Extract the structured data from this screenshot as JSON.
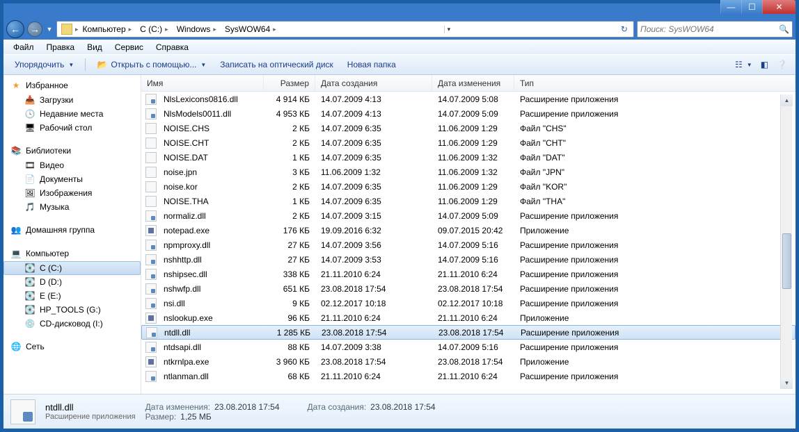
{
  "window": {
    "title": ""
  },
  "nav": {
    "breadcrumb": [
      "Компьютер",
      "C (C:)",
      "Windows",
      "SysWOW64"
    ],
    "search_placeholder": "Поиск: SysWOW64"
  },
  "menubar": [
    "Файл",
    "Правка",
    "Вид",
    "Сервис",
    "Справка"
  ],
  "toolbar": {
    "organize": "Упорядочить",
    "open_with": "Открыть с помощью...",
    "burn": "Записать на оптический диск",
    "new_folder": "Новая папка"
  },
  "sidebar": {
    "favorites": {
      "title": "Избранное",
      "items": [
        "Загрузки",
        "Недавние места",
        "Рабочий стол"
      ]
    },
    "libraries": {
      "title": "Библиотеки",
      "items": [
        "Видео",
        "Документы",
        "Изображения",
        "Музыка"
      ]
    },
    "homegroup": {
      "title": "Домашняя группа"
    },
    "computer": {
      "title": "Компьютер",
      "items": [
        "C (C:)",
        "D (D:)",
        "E (E:)",
        "HP_TOOLS (G:)",
        "CD-дисковод (I:)"
      ]
    },
    "network": {
      "title": "Сеть"
    }
  },
  "columns": {
    "name": "Имя",
    "size": "Размер",
    "created": "Дата создания",
    "modified": "Дата изменения",
    "type": "Тип"
  },
  "files": [
    {
      "icon": "dll",
      "name": "NlsLexicons0816.dll",
      "size": "4 914 КБ",
      "created": "14.07.2009 4:13",
      "modified": "14.07.2009 5:08",
      "type": "Расширение приложения"
    },
    {
      "icon": "dll",
      "name": "NlsModels0011.dll",
      "size": "4 953 КБ",
      "created": "14.07.2009 4:13",
      "modified": "14.07.2009 5:09",
      "type": "Расширение приложения"
    },
    {
      "icon": "file",
      "name": "NOISE.CHS",
      "size": "2 КБ",
      "created": "14.07.2009 6:35",
      "modified": "11.06.2009 1:29",
      "type": "Файл \"CHS\""
    },
    {
      "icon": "file",
      "name": "NOISE.CHT",
      "size": "2 КБ",
      "created": "14.07.2009 6:35",
      "modified": "11.06.2009 1:29",
      "type": "Файл \"CHT\""
    },
    {
      "icon": "file",
      "name": "NOISE.DAT",
      "size": "1 КБ",
      "created": "14.07.2009 6:35",
      "modified": "11.06.2009 1:32",
      "type": "Файл \"DAT\""
    },
    {
      "icon": "file",
      "name": "noise.jpn",
      "size": "3 КБ",
      "created": "11.06.2009 1:32",
      "modified": "11.06.2009 1:32",
      "type": "Файл \"JPN\""
    },
    {
      "icon": "file",
      "name": "noise.kor",
      "size": "2 КБ",
      "created": "14.07.2009 6:35",
      "modified": "11.06.2009 1:29",
      "type": "Файл \"KOR\""
    },
    {
      "icon": "file",
      "name": "NOISE.THA",
      "size": "1 КБ",
      "created": "14.07.2009 6:35",
      "modified": "11.06.2009 1:29",
      "type": "Файл \"THA\""
    },
    {
      "icon": "dll",
      "name": "normaliz.dll",
      "size": "2 КБ",
      "created": "14.07.2009 3:15",
      "modified": "14.07.2009 5:09",
      "type": "Расширение приложения"
    },
    {
      "icon": "exe",
      "name": "notepad.exe",
      "size": "176 КБ",
      "created": "19.09.2016 6:32",
      "modified": "09.07.2015 20:42",
      "type": "Приложение"
    },
    {
      "icon": "dll",
      "name": "npmproxy.dll",
      "size": "27 КБ",
      "created": "14.07.2009 3:56",
      "modified": "14.07.2009 5:16",
      "type": "Расширение приложения"
    },
    {
      "icon": "dll",
      "name": "nshhttp.dll",
      "size": "27 КБ",
      "created": "14.07.2009 3:53",
      "modified": "14.07.2009 5:16",
      "type": "Расширение приложения"
    },
    {
      "icon": "dll",
      "name": "nshipsec.dll",
      "size": "338 КБ",
      "created": "21.11.2010 6:24",
      "modified": "21.11.2010 6:24",
      "type": "Расширение приложения"
    },
    {
      "icon": "dll",
      "name": "nshwfp.dll",
      "size": "651 КБ",
      "created": "23.08.2018 17:54",
      "modified": "23.08.2018 17:54",
      "type": "Расширение приложения"
    },
    {
      "icon": "dll",
      "name": "nsi.dll",
      "size": "9 КБ",
      "created": "02.12.2017 10:18",
      "modified": "02.12.2017 10:18",
      "type": "Расширение приложения"
    },
    {
      "icon": "exe",
      "name": "nslookup.exe",
      "size": "96 КБ",
      "created": "21.11.2010 6:24",
      "modified": "21.11.2010 6:24",
      "type": "Приложение"
    },
    {
      "icon": "dll",
      "name": "ntdll.dll",
      "size": "1 285 КБ",
      "created": "23.08.2018 17:54",
      "modified": "23.08.2018 17:54",
      "type": "Расширение приложения",
      "selected": true
    },
    {
      "icon": "dll",
      "name": "ntdsapi.dll",
      "size": "88 КБ",
      "created": "14.07.2009 3:38",
      "modified": "14.07.2009 5:16",
      "type": "Расширение приложения"
    },
    {
      "icon": "exe",
      "name": "ntkrnlpa.exe",
      "size": "3 960 КБ",
      "created": "23.08.2018 17:54",
      "modified": "23.08.2018 17:54",
      "type": "Приложение"
    },
    {
      "icon": "dll",
      "name": "ntlanman.dll",
      "size": "68 КБ",
      "created": "21.11.2010 6:24",
      "modified": "21.11.2010 6:24",
      "type": "Расширение приложения"
    }
  ],
  "details": {
    "filename": "ntdll.dll",
    "filetype": "Расширение приложения",
    "props": [
      {
        "label": "Дата изменения:",
        "value": "23.08.2018 17:54"
      },
      {
        "label": "Размер:",
        "value": "1,25 МБ"
      },
      {
        "label": "Дата создания:",
        "value": "23.08.2018 17:54"
      }
    ]
  }
}
